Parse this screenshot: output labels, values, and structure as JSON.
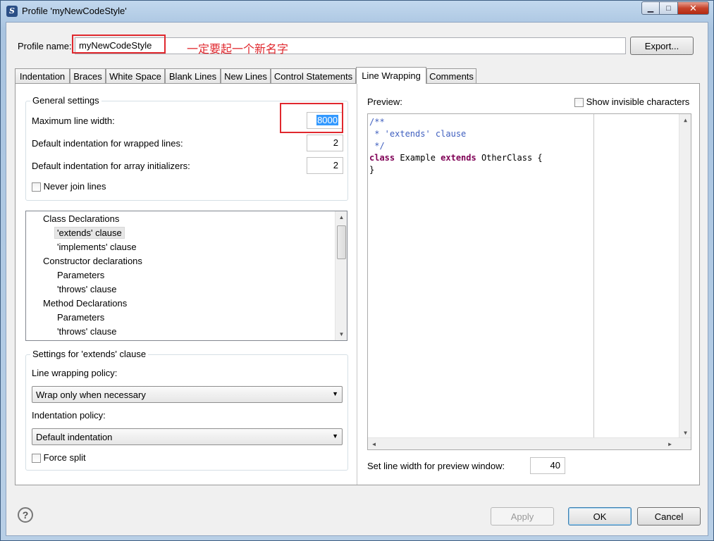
{
  "window": {
    "title": "Profile 'myNewCodeStyle'",
    "app_icon_glyph": "S",
    "minimize": "▁",
    "maximize": "□",
    "close": "✕"
  },
  "profile": {
    "label": "Profile name:",
    "value": "myNewCodeStyle",
    "annotation": "一定要起一个新名字",
    "export_button": "Export..."
  },
  "tabs": [
    {
      "label": "Indentation"
    },
    {
      "label": "Braces"
    },
    {
      "label": "White Space"
    },
    {
      "label": "Blank Lines"
    },
    {
      "label": "New Lines"
    },
    {
      "label": "Control Statements"
    },
    {
      "label": "Line Wrapping",
      "active": true
    },
    {
      "label": "Comments"
    }
  ],
  "general": {
    "title": "General settings",
    "max_width_label": "Maximum line width:",
    "max_width_value": "8000",
    "wrapped_indent_label": "Default indentation for wrapped lines:",
    "wrapped_indent_value": "2",
    "array_indent_label": "Default indentation for array initializers:",
    "array_indent_value": "2",
    "never_join_label": "Never join lines",
    "never_join_checked": false
  },
  "tree": {
    "items": [
      {
        "label": "Class Declarations",
        "level": 0
      },
      {
        "label": "'extends' clause",
        "level": 1,
        "selected": true
      },
      {
        "label": "'implements' clause",
        "level": 1
      },
      {
        "label": "Constructor declarations",
        "level": 0
      },
      {
        "label": "Parameters",
        "level": 1
      },
      {
        "label": "'throws' clause",
        "level": 1
      },
      {
        "label": "Method Declarations",
        "level": 0
      },
      {
        "label": "Parameters",
        "level": 1
      },
      {
        "label": "'throws' clause",
        "level": 1
      }
    ]
  },
  "settings": {
    "title": "Settings for 'extends' clause",
    "wrap_policy_label": "Line wrapping policy:",
    "wrap_policy_value": "Wrap only when necessary",
    "indent_policy_label": "Indentation policy:",
    "indent_policy_value": "Default indentation",
    "force_split_label": "Force split",
    "force_split_checked": false
  },
  "preview": {
    "label": "Preview:",
    "show_invisible_label": "Show invisible characters",
    "show_invisible_checked": false,
    "code": {
      "line1": "/**",
      "line2": " * 'extends' clause",
      "line3": " */",
      "kw_class": "class",
      "name": " Example ",
      "kw_extends": "extends",
      "rest": " OtherClass {",
      "line5": "}"
    },
    "line_width_label": "Set line width for preview window:",
    "line_width_value": "40"
  },
  "footer": {
    "help": "?",
    "apply": "Apply",
    "ok": "OK",
    "cancel": "Cancel"
  },
  "colors": {
    "annotation": "#e0282e",
    "comment": "#3f5fbf",
    "keyword": "#7f0055"
  }
}
